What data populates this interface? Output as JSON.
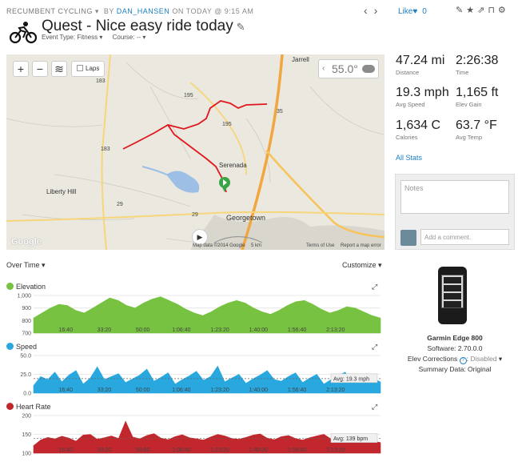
{
  "header": {
    "category": "RECUMBENT CYCLING",
    "by": "BY",
    "user": "DAN_HANSEN",
    "when": "ON TODAY @ 9:15 AM",
    "like_label": "Like",
    "like_count": "0"
  },
  "activity": {
    "title": "Quest - Nice easy ride today",
    "event_type": "Event Type: Fitness",
    "course": "Course: --"
  },
  "map": {
    "laps_label": "Laps",
    "temperature": "55.0°",
    "towns": [
      "Jarrell",
      "Serenada",
      "Georgetown",
      "Liberty Hill"
    ],
    "roads": [
      "195",
      "195",
      "183",
      "183",
      "29",
      "29",
      "35"
    ],
    "attribution": "Map data ©2014 Google",
    "scale": "5 km",
    "terms": "Terms of Use",
    "report": "Report a map error",
    "google": "Google"
  },
  "stats": [
    {
      "value": "47.24 mi",
      "label": "Distance"
    },
    {
      "value": "2:26:38",
      "label": "Time"
    },
    {
      "value": "19.3 mph",
      "label": "Avg Speed"
    },
    {
      "value": "1,165 ft",
      "label": "Elev Gain"
    },
    {
      "value": "1,634 C",
      "label": "Calories"
    },
    {
      "value": "63.7 °F",
      "label": "Avg Temp"
    }
  ],
  "all_stats": "All Stats",
  "notes_placeholder": "Notes",
  "comment_placeholder": "Add a comment.",
  "device": {
    "name": "Garmin Edge 800",
    "software": "Software: 2.70.0.0",
    "elev_corrections_label": "Elev Corrections",
    "elev_corrections_value": "Disabled",
    "summary": "Summary Data: Original"
  },
  "charts_header": {
    "over_time": "Over Time",
    "customize": "Customize"
  },
  "colors": {
    "elevation": "#77c240",
    "speed": "#29a8e0",
    "heart": "#c1272d",
    "link": "#1a7fc1"
  },
  "chart_data": [
    {
      "type": "area",
      "title": "Elevation",
      "x": [
        "16:40",
        "33:20",
        "50:00",
        "1:06:40",
        "1:23:20",
        "1:40:00",
        "1:56:40",
        "2:13:20"
      ],
      "y_ticks": [
        700,
        800,
        900,
        1000
      ],
      "ylim": [
        700,
        1000
      ],
      "values": [
        820,
        860,
        900,
        930,
        920,
        880,
        860,
        900,
        940,
        980,
        960,
        920,
        900,
        940,
        970,
        990,
        960,
        930,
        890,
        860,
        840,
        870,
        910,
        940,
        960,
        940,
        900,
        870,
        850,
        880,
        920,
        950,
        960,
        930,
        890,
        860,
        880,
        910,
        900,
        870,
        840,
        820
      ]
    },
    {
      "type": "area",
      "title": "Speed",
      "x": [
        "16:40",
        "33:20",
        "50:00",
        "1:06:40",
        "1:23:20",
        "1:40:00",
        "1:56:40",
        "2:13:20"
      ],
      "y_ticks": [
        0.0,
        25.0,
        50.0
      ],
      "ylim": [
        0,
        50
      ],
      "average": "Avg: 19.3 mph",
      "average_value": 19.3,
      "values": [
        10,
        22,
        18,
        28,
        15,
        24,
        30,
        12,
        20,
        35,
        18,
        22,
        26,
        14,
        19,
        24,
        32,
        16,
        21,
        27,
        12,
        18,
        23,
        29,
        17,
        22,
        36,
        15,
        20,
        25,
        13,
        19,
        24,
        30,
        18,
        16,
        22,
        27,
        14,
        20,
        25,
        12,
        18,
        23,
        28,
        16,
        21,
        26,
        19,
        15
      ]
    },
    {
      "type": "area",
      "title": "Heart Rate",
      "x": [
        "16:40",
        "33:20",
        "50:00",
        "1:06:40",
        "1:23:20",
        "1:40:00",
        "1:56:40",
        "2:13:20"
      ],
      "y_ticks": [
        100,
        150,
        200
      ],
      "ylim": [
        100,
        200
      ],
      "average": "Avg: 139 bpm",
      "average_value": 139,
      "values": [
        120,
        135,
        142,
        138,
        145,
        140,
        132,
        148,
        150,
        137,
        141,
        146,
        139,
        185,
        143,
        138,
        147,
        152,
        140,
        136,
        144,
        149,
        141,
        138,
        135,
        143,
        150,
        146,
        139,
        137,
        142,
        148,
        151,
        140,
        136,
        144,
        147,
        139,
        135,
        141,
        146,
        150,
        138,
        134,
        143,
        147,
        140,
        136,
        132,
        128
      ]
    }
  ]
}
